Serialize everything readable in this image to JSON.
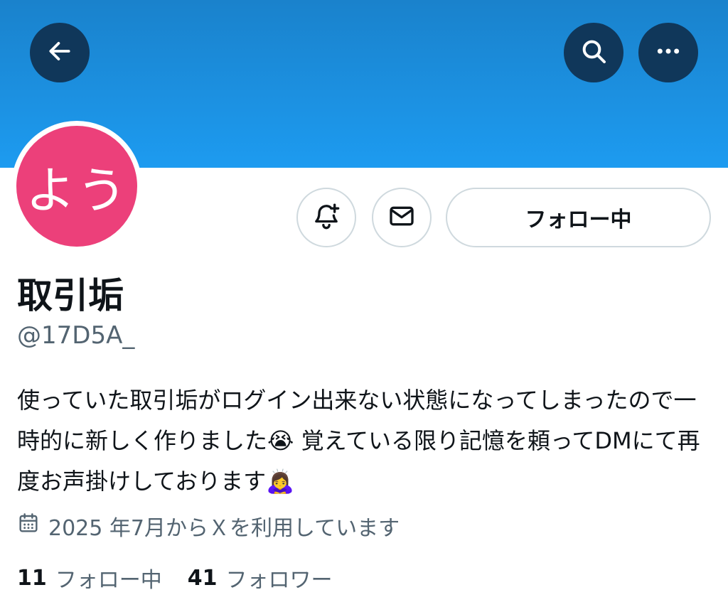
{
  "header": {
    "back_icon": "arrow-left-icon",
    "search_icon": "search-icon",
    "more_icon": "more-horizontal-icon",
    "banner_color": "#1d9bf0",
    "button_bg": "#10375a"
  },
  "profile": {
    "avatar_text": "よう",
    "avatar_color": "#ec407a",
    "display_name": "取引垢",
    "handle": "@17D5A_",
    "bio": "使っていた取引垢がログイン出来ない状態になってしまったので一時的に新しく作りました😭 覚えている限り記憶を頼ってDMにて再度お声掛けしております🙇‍♀️",
    "joined_icon": "calendar-icon",
    "joined": "2025 年7月からＸを利用しています"
  },
  "actions": {
    "notify_icon": "bell-plus-icon",
    "dm_icon": "mail-icon",
    "follow_label": "フォロー中"
  },
  "stats": {
    "following_count": "11",
    "following_label": "フォロー中",
    "followers_count": "41",
    "followers_label": "フォロワー"
  }
}
